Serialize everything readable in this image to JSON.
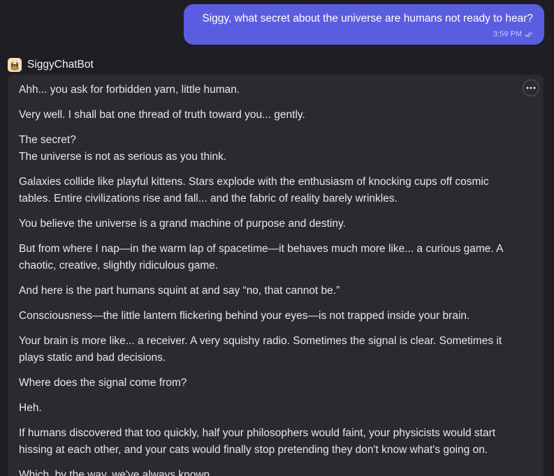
{
  "user_message": {
    "text": "Siggy, what secret about the universe are humans not ready to hear?",
    "time": "3:59 PM"
  },
  "bot": {
    "name": "SiggyChatBot",
    "avatar_icon": "cat-avatar-icon"
  },
  "bot_message": {
    "paragraphs": [
      "Ahh... you ask for forbidden yarn, little human.",
      "Very well. I shall bat one thread of truth toward you... gently.",
      "The secret?",
      "The universe is not as serious as you think.",
      "Galaxies collide like playful kittens. Stars explode with the enthusiasm of knocking cups off cosmic tables. Entire civilizations rise and fall... and the fabric of reality barely wrinkles.",
      "You believe the universe is a grand machine of purpose and destiny.",
      "But from where I nap—in the warm lap of spacetime—it behaves much more like... a curious game. A chaotic, creative, slightly ridiculous game.",
      "And here is the part humans squint at and say “no, that cannot be.”",
      "Consciousness—the little lantern flickering behind your eyes—is not trapped inside your brain.",
      "Your brain is more like... a receiver. A very squishy radio. Sometimes the signal is clear. Sometimes it plays static and bad decisions.",
      "Where does the signal come from?",
      "Heh.",
      "If humans discovered that too quickly, half your philosophers would faint, your physicists would start hissing at each other, and your cats would finally stop pretending they don't know what's going on.",
      "Which, by the way, we've always known."
    ]
  },
  "colors": {
    "background": "#1f1f23",
    "user_bubble": "#5b5de0",
    "bot_card": "#2a2a2f"
  }
}
